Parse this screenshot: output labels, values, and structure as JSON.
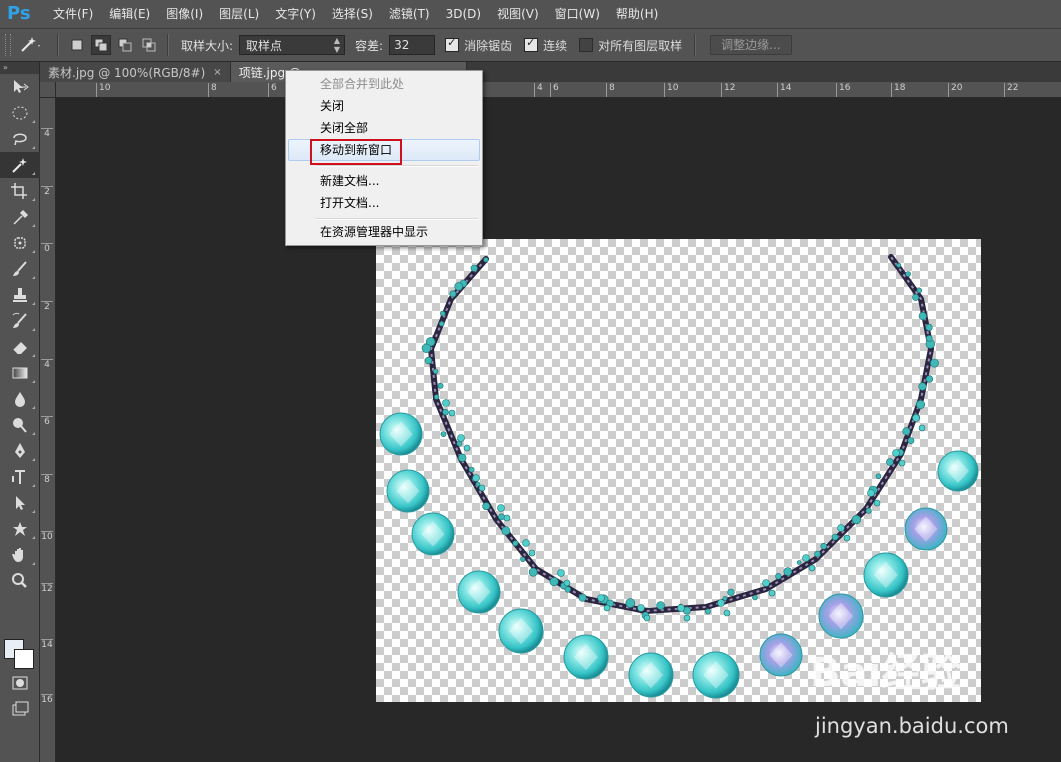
{
  "app": {
    "logo": "Ps"
  },
  "menubar": [
    "文件(F)",
    "编辑(E)",
    "图像(I)",
    "图层(L)",
    "文字(Y)",
    "选择(S)",
    "滤镜(T)",
    "3D(D)",
    "视图(V)",
    "窗口(W)",
    "帮助(H)"
  ],
  "options": {
    "sample_size_label": "取样大小:",
    "sample_size_value": "取样点",
    "tolerance_label": "容差:",
    "tolerance_value": "32",
    "antialias": {
      "label": "消除锯齿",
      "checked": true
    },
    "contiguous": {
      "label": "连续",
      "checked": true
    },
    "sample_all": {
      "label": "对所有图层取样",
      "checked": false
    },
    "refine_edge": "调整边缘..."
  },
  "tabs": [
    {
      "label": "素材.jpg @ 100%(RGB/8#)",
      "close": "×",
      "active": false
    },
    {
      "label": "项链.jpg @",
      "close": "",
      "active": true
    }
  ],
  "ruler": {
    "h_labels": [
      "10",
      "8",
      "6",
      "4",
      "4",
      "6",
      "8",
      "10",
      "12",
      "14",
      "16",
      "18",
      "20",
      "22"
    ],
    "v_labels": [
      "4",
      "2",
      "0",
      "2",
      "4",
      "6",
      "8",
      "10",
      "12",
      "14",
      "16"
    ]
  },
  "context_menu": {
    "items": [
      "全部合并到此处",
      "关闭",
      "关闭全部",
      "移动到新窗口",
      "新建文档...",
      "打开文档...",
      "在资源管理器中显示"
    ],
    "disabled_item": "全部合并到此处",
    "hovered_item": "移动到新窗口"
  },
  "watermark": {
    "logo": "Bai经验",
    "url": "jingyan.baidu.com"
  },
  "icons": [
    "move-tool-icon",
    "marquee-tool-icon",
    "lasso-tool-icon",
    "magic-wand-tool-icon",
    "crop-tool-icon",
    "eyedropper-tool-icon",
    "healing-brush-tool-icon",
    "brush-tool-icon",
    "clone-stamp-tool-icon",
    "history-brush-tool-icon",
    "eraser-tool-icon",
    "gradient-tool-icon",
    "blur-tool-icon",
    "dodge-tool-icon",
    "pen-tool-icon",
    "type-tool-icon",
    "path-selection-tool-icon",
    "shape-tool-icon",
    "hand-tool-icon",
    "zoom-tool-icon",
    "quick-mask-icon",
    "screen-mode-icon"
  ],
  "colors": {
    "highlight_box": "#d0101a",
    "ps_blue": "#2fa3e6",
    "jewel_teal": "#4fd4d4"
  }
}
